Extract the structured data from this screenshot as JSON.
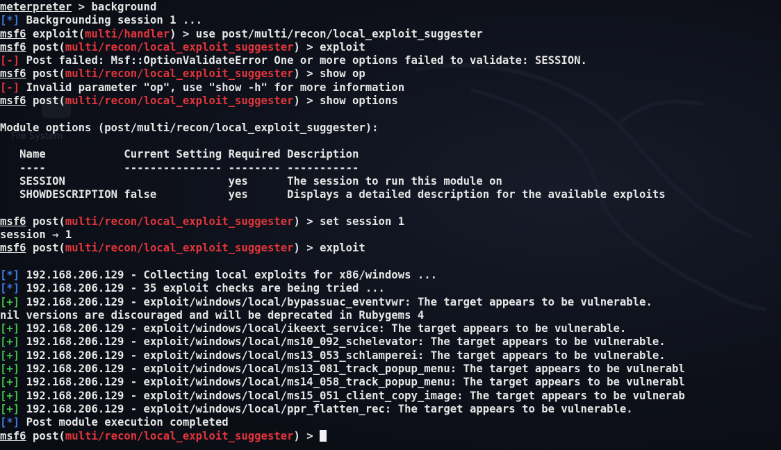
{
  "accent": {
    "module_red": "#e0353b",
    "info_blue": "#3f78e0",
    "good_green": "#3fbf4a",
    "error_red": "#e0353b",
    "text": "#e6e6e6",
    "background": "#0c0e16"
  },
  "background_hint": "File System",
  "cmds": {
    "background": "background",
    "use": "use post/multi/recon/local_exploit_suggester",
    "exploit": "exploit",
    "show_op": "show op",
    "show_options": "show options",
    "set_session": "set session 1"
  },
  "prompts": {
    "meterpreter": "meterpreter",
    "msf6": "msf6",
    "exploit_word": "exploit",
    "post_word": "post",
    "handler_module": "multi/handler",
    "suggester_module": "multi/recon/local_exploit_suggester",
    "arrow": " > "
  },
  "out": {
    "backgrounding": "Backgrounding session 1 ...",
    "post_failed": "Post failed: Msf::OptionValidateError One or more options failed to validate: SESSION.",
    "invalid_param": "Invalid parameter \"op\", use \"show -h\" for more information",
    "module_options_header": "Module options (post/multi/recon/local_exploit_suggester):",
    "session_set": "session ⇒ 1",
    "nil_warning": "nil versions are discouraged and will be deprecated in Rubygems 4",
    "completed": "Post module execution completed"
  },
  "markers": {
    "info": "[*]",
    "good": "[+]",
    "error": "[-]"
  },
  "options_table": {
    "headers": [
      "Name",
      "Current Setting",
      "Required",
      "Description"
    ],
    "separators": [
      "----",
      "---------------",
      "--------",
      "-----------"
    ],
    "rows": [
      [
        "SESSION",
        "",
        "yes",
        "The session to run this module on"
      ],
      [
        "SHOWDESCRIPTION",
        "false",
        "yes",
        "Displays a detailed description for the available exploits"
      ]
    ]
  },
  "results": [
    {
      "type": "info",
      "text": "192.168.206.129 - Collecting local exploits for x86/windows ..."
    },
    {
      "type": "info",
      "text": "192.168.206.129 - 35 exploit checks are being tried ..."
    },
    {
      "type": "good",
      "text": "192.168.206.129 - exploit/windows/local/bypassuac_eventvwr: The target appears to be vulnerable."
    },
    {
      "type": "plain",
      "text": "nil versions are discouraged and will be deprecated in Rubygems 4"
    },
    {
      "type": "good",
      "text": "192.168.206.129 - exploit/windows/local/ikeext_service: The target appears to be vulnerable."
    },
    {
      "type": "good",
      "text": "192.168.206.129 - exploit/windows/local/ms10_092_schelevator: The target appears to be vulnerable."
    },
    {
      "type": "good",
      "text": "192.168.206.129 - exploit/windows/local/ms13_053_schlamperei: The target appears to be vulnerable."
    },
    {
      "type": "good",
      "text": "192.168.206.129 - exploit/windows/local/ms13_081_track_popup_menu: The target appears to be vulnerabl"
    },
    {
      "type": "good",
      "text": "192.168.206.129 - exploit/windows/local/ms14_058_track_popup_menu: The target appears to be vulnerabl"
    },
    {
      "type": "good",
      "text": "192.168.206.129 - exploit/windows/local/ms15_051_client_copy_image: The target appears to be vulnerab"
    },
    {
      "type": "good",
      "text": "192.168.206.129 - exploit/windows/local/ppr_flatten_rec: The target appears to be vulnerable."
    }
  ]
}
